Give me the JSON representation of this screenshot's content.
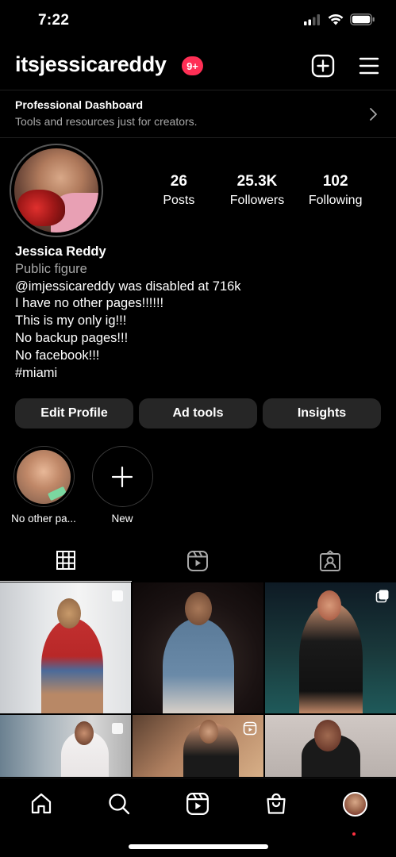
{
  "status_bar": {
    "time": "7:22"
  },
  "header": {
    "username": "itsjessicareddy",
    "notification_badge": "9+"
  },
  "dashboard": {
    "title": "Professional Dashboard",
    "subtitle": "Tools and resources just for creators."
  },
  "profile": {
    "stats": [
      {
        "value": "26",
        "label": "Posts"
      },
      {
        "value": "25.3K",
        "label": "Followers"
      },
      {
        "value": "102",
        "label": "Following"
      }
    ],
    "name": "Jessica Reddy",
    "category": "Public figure",
    "bio_lines": [
      "@imjessicareddy was disabled at 716k",
      "I have no other pages!!!!!!",
      "This is my only ig!!!",
      "No backup pages!!!",
      "No facebook!!!",
      "#miami"
    ]
  },
  "actions": {
    "edit_profile": "Edit Profile",
    "ad_tools": "Ad tools",
    "insights": "Insights"
  },
  "highlights": [
    {
      "label": "No other pa..."
    },
    {
      "label": "New"
    }
  ],
  "tabs": [
    {
      "name": "grid-icon",
      "active": true
    },
    {
      "name": "reels-icon",
      "active": false
    },
    {
      "name": "tagged-icon",
      "active": false
    }
  ],
  "bottom_nav": [
    {
      "name": "home-icon"
    },
    {
      "name": "search-icon"
    },
    {
      "name": "reels-icon"
    },
    {
      "name": "shop-icon"
    },
    {
      "name": "profile-avatar"
    }
  ],
  "colors": {
    "background": "#000000",
    "badge": "#ff2f55",
    "button": "#262626",
    "muted_text": "#a8a8a8"
  }
}
